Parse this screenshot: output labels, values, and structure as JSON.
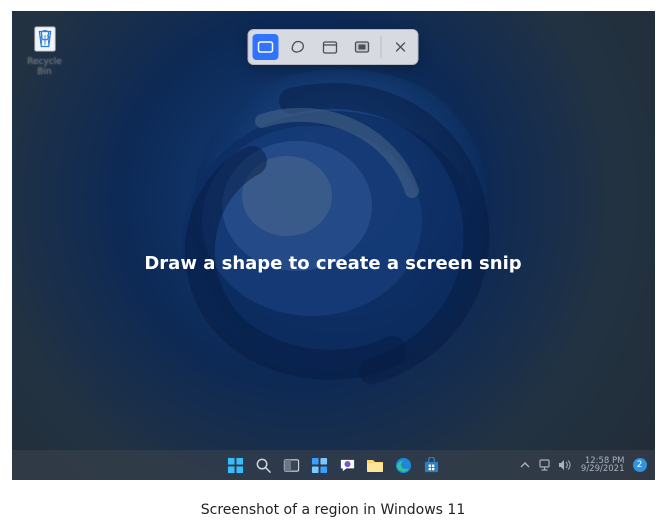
{
  "desktop_icons": {
    "recycle_bin": "Recycle Bin"
  },
  "snip": {
    "instruction": "Draw a shape to create a screen snip",
    "modes": {
      "rectangular": "Rectangular",
      "freeform": "Freeform",
      "window": "Window",
      "fullscreen": "Fullscreen"
    },
    "close": "Close"
  },
  "taskbar": {
    "items": {
      "start": "Start",
      "search": "Search",
      "task_view": "Task View",
      "widgets": "Widgets",
      "chat": "Chat",
      "file_explorer": "File Explorer",
      "edge": "Edge",
      "store": "Microsoft Store"
    },
    "tray": {
      "chevron": "Show hidden icons",
      "network": "Network",
      "volume": "Volume",
      "time": "12:58 PM",
      "date": "9/29/2021",
      "notifications": "2"
    }
  },
  "caption": "Screenshot of a region in Windows 11"
}
